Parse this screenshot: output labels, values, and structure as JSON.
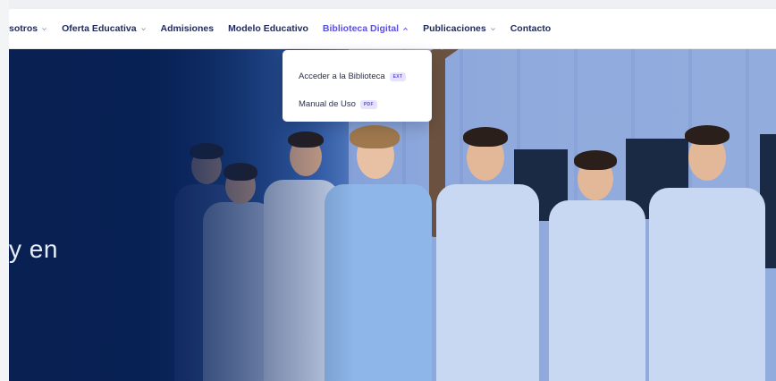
{
  "nav": {
    "items": [
      {
        "label": "sotros",
        "has_chevron": true,
        "expanded": false
      },
      {
        "label": "Oferta Educativa",
        "has_chevron": true,
        "expanded": false
      },
      {
        "label": "Admisiones",
        "has_chevron": false
      },
      {
        "label": "Modelo Educativo",
        "has_chevron": false
      },
      {
        "label": "Biblioteca Digital",
        "has_chevron": true,
        "expanded": true
      },
      {
        "label": "Publicaciones",
        "has_chevron": true,
        "expanded": false
      },
      {
        "label": "Contacto",
        "has_chevron": false
      }
    ],
    "active_color": "#5b4fe0",
    "text_color": "#1f2a5a"
  },
  "dropdown": {
    "items": [
      {
        "label": "Acceder a la Biblioteca",
        "badge": "EXT"
      },
      {
        "label": "Manual de Uso",
        "badge": "PDF"
      }
    ]
  },
  "hero": {
    "text": "y en"
  }
}
